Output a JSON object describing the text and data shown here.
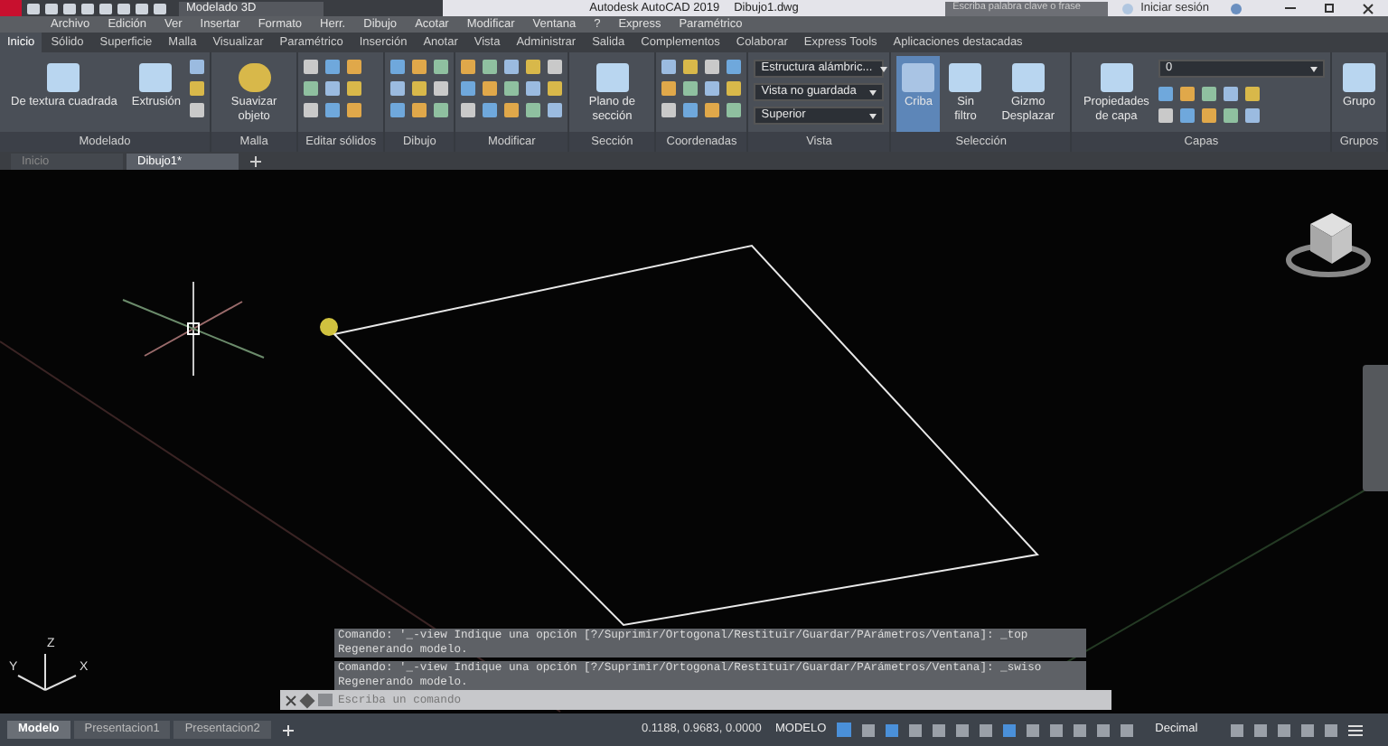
{
  "window": {
    "workspace": "Modelado 3D",
    "title": "Autodesk AutoCAD 2019",
    "document": "Dibujo1.dwg",
    "search": {
      "placeholder": "Escriba palabra clave o frase"
    },
    "sign_in": "Iniciar sesión"
  },
  "menu_bar": [
    "Archivo",
    "Edición",
    "Ver",
    "Insertar",
    "Formato",
    "Herr.",
    "Dibujo",
    "Acotar",
    "Modificar",
    "Ventana",
    "?",
    "Express",
    "Paramétrico"
  ],
  "ribbon_tabs": [
    {
      "label": "Inicio",
      "selected": true
    },
    {
      "label": "Sólido",
      "selected": false
    },
    {
      "label": "Superficie",
      "selected": false
    },
    {
      "label": "Malla",
      "selected": false
    },
    {
      "label": "Visualizar",
      "selected": false
    },
    {
      "label": "Paramétrico",
      "selected": false
    },
    {
      "label": "Inserción",
      "selected": false
    },
    {
      "label": "Anotar",
      "selected": false
    },
    {
      "label": "Vista",
      "selected": false
    },
    {
      "label": "Administrar",
      "selected": false
    },
    {
      "label": "Salida",
      "selected": false
    },
    {
      "label": "Complementos",
      "selected": false
    },
    {
      "label": "Colaborar",
      "selected": false
    },
    {
      "label": "Express Tools",
      "selected": false
    },
    {
      "label": "Aplicaciones destacadas",
      "selected": false
    }
  ],
  "ribbon_panels": [
    {
      "title": "Modelado",
      "tools": [
        {
          "label": "De textura cuadrada",
          "selected": false
        },
        {
          "label": "Extrusión",
          "selected": false
        }
      ]
    },
    {
      "title": "Malla",
      "tools": [
        {
          "label": "Suavizar objeto",
          "selected": false
        }
      ]
    },
    {
      "title": "Editar sólidos"
    },
    {
      "title": "Dibujo"
    },
    {
      "title": "Modificar"
    },
    {
      "title": "Sección",
      "tools": [
        {
          "label": "Plano de sección",
          "selected": false
        }
      ]
    },
    {
      "title": "Coordenadas"
    },
    {
      "title": "Vista",
      "dropdowns": [
        "Estructura alámbric...",
        "Vista no guardada",
        "Superior"
      ]
    },
    {
      "title": "Selección",
      "tools": [
        {
          "label": "Criba",
          "selected": true
        },
        {
          "label": "Sin filtro",
          "selected": false
        },
        {
          "label": "Gizmo Desplazar",
          "selected": false
        }
      ]
    },
    {
      "title": "Capas",
      "tools": [
        {
          "label": "Propiedades de capa",
          "selected": false
        }
      ],
      "dropdowns": [
        "0"
      ]
    },
    {
      "title": "Grupos",
      "tools": [
        {
          "label": "Grupo",
          "selected": false
        }
      ]
    }
  ],
  "document_tabs": [
    {
      "label": "Inicio",
      "selected": false
    },
    {
      "label": "Dibujo1*",
      "selected": true
    }
  ],
  "command_history": [
    "Comando: '_-view Indique una opción [?/Suprimir/Ortogonal/Restituir/Guardar/PArámetros/Ventana]: _top Regenerando modelo.",
    "Comando: '_-view Indique una opción [?/Suprimir/Ortogonal/Restituir/Guardar/PArámetros/Ventana]: _swiso Regenerando modelo."
  ],
  "ucs_labels": [
    "Z",
    "Y",
    "X"
  ],
  "command_line": {
    "placeholder": "Escriba un comando"
  },
  "layout_tabs": [
    {
      "label": "Modelo",
      "selected": true
    },
    {
      "label": "Presentacion1",
      "selected": false
    },
    {
      "label": "Presentacion2",
      "selected": false
    }
  ],
  "status_bar": {
    "coordinates": "0.1188, 0.9683, 0.0000",
    "space": "MODELO",
    "units": "Decimal"
  }
}
